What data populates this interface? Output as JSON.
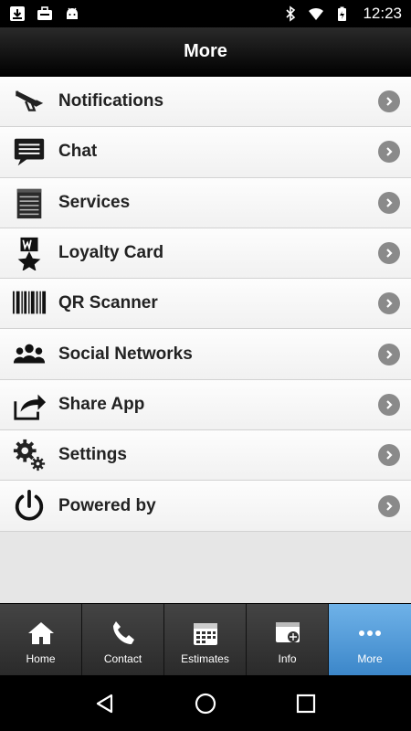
{
  "status_bar": {
    "time": "12:23",
    "left_icons": [
      "download-icon",
      "briefcase-icon",
      "android-icon"
    ],
    "right_icons": [
      "bluetooth-icon",
      "wifi-icon",
      "battery-icon"
    ]
  },
  "header": {
    "title": "More"
  },
  "menu": {
    "items": [
      {
        "label": "Notifications",
        "icon": "megaphone-icon"
      },
      {
        "label": "Chat",
        "icon": "chat-bubble-icon"
      },
      {
        "label": "Services",
        "icon": "notepad-icon"
      },
      {
        "label": "Loyalty Card",
        "icon": "loyalty-star-icon"
      },
      {
        "label": "QR Scanner",
        "icon": "barcode-icon"
      },
      {
        "label": "Social Networks",
        "icon": "people-icon"
      },
      {
        "label": "Share App",
        "icon": "share-arrow-icon"
      },
      {
        "label": "Settings",
        "icon": "gears-icon"
      },
      {
        "label": "Powered by",
        "icon": "power-icon"
      }
    ]
  },
  "tabs": [
    {
      "label": "Home",
      "icon": "home-icon",
      "active": false
    },
    {
      "label": "Contact",
      "icon": "phone-icon",
      "active": false
    },
    {
      "label": "Estimates",
      "icon": "calendar-icon",
      "active": false
    },
    {
      "label": "Info",
      "icon": "info-window-icon",
      "active": false
    },
    {
      "label": "More",
      "icon": "more-dots-icon",
      "active": true
    }
  ],
  "colors": {
    "active_tab": "#4a95d6",
    "header": "#111111",
    "chevron": "#8a8a8a"
  }
}
